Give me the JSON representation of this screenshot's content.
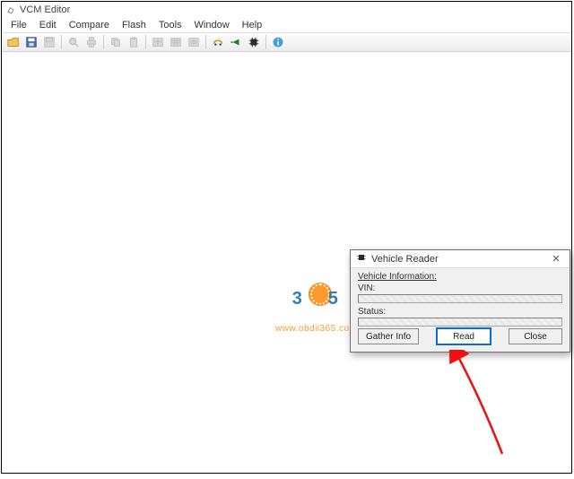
{
  "app": {
    "title": "VCM Editor"
  },
  "menu": {
    "file": "File",
    "edit": "Edit",
    "compare": "Compare",
    "flash": "Flash",
    "tools": "Tools",
    "window": "Window",
    "help": "Help"
  },
  "watermark": {
    "url": "www.obdii365.com"
  },
  "dialog": {
    "title": "Vehicle Reader",
    "section": "Vehicle Information:",
    "vin_label": "VIN:",
    "status_label": "Status:",
    "gather": "Gather Info",
    "read": "Read",
    "close": "Close"
  }
}
